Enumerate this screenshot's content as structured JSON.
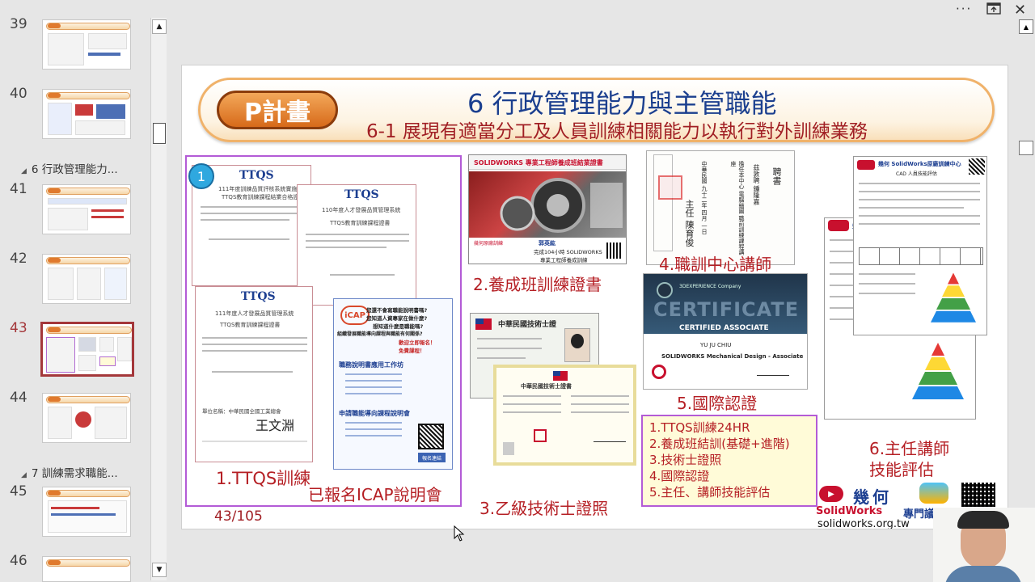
{
  "thumbnails": {
    "items": [
      {
        "number": "39"
      },
      {
        "number": "40"
      },
      {
        "number": "41"
      },
      {
        "number": "42"
      },
      {
        "number": "43",
        "active": true
      },
      {
        "number": "44"
      },
      {
        "number": "45"
      },
      {
        "number": "46"
      }
    ],
    "sections": [
      {
        "label": "6 行政管理能力..."
      },
      {
        "label": "7 訓練需求職能..."
      }
    ]
  },
  "window": {
    "more_icon": "more-icon",
    "restore_icon": "restore-icon",
    "close_icon": "close-icon"
  },
  "slide": {
    "badge": "P計畫",
    "title": "6 行政管理能力與主管職能",
    "subtitle": "6-1 展現有適當分工及人員訓練相關能力以執行對外訓練業務",
    "page_counter": "43/105",
    "ttqs_doc": {
      "number_badge": "1",
      "logo": "TTQS",
      "doc1_title": "111年度訓練品質評核系統實施計",
      "doc1_sub": "TTQS教育訓練課程結業合格證書",
      "doc2_title": "110年度人才發展品質管理系統",
      "doc2_sub": "TTQS教育訓練課程證書",
      "doc3_title": "111年度人才發展品質管理系統",
      "doc3_sub": "TTQS教育訓練課程證書",
      "signer_org": "單位名稱：中華民國全國工業總會",
      "signer_name": "王文淵",
      "caption": "1.TTQS訓練",
      "icap_caption": "已報名ICAP說明會"
    },
    "icap_flyer": {
      "logo": "iCAP",
      "q1": "您還不會寫職能說明書嗎?",
      "q2": "您知道人資專家在做什麼?",
      "q3": "想知道什麼是職能嗎?",
      "q4": "組織發展職能導向課程與職能有何關係?",
      "q5": "歡迎立即報名！",
      "q6": "免費課程！",
      "sec1": "職務說明書應用工作坊",
      "sec2": "申請職能導向課程說明會",
      "btn": "報名連結"
    },
    "cert2": {
      "header": "SOLIDWORKS 專業工程師養成班結業證書",
      "line1": "幾何原廠訓練",
      "name": "郭英紘",
      "line2": "完成104小時 SOLIDWORKS",
      "line3": "專業工程師養成訓練",
      "caption": "2.養成班訓練證書"
    },
    "cert3": {
      "id_header": "中華民國技術士證",
      "card_title": "中華民國技術士證書",
      "caption": "3.乙級技術士證照"
    },
    "cert4": {
      "hire": "聘書",
      "text1": "茲敦聘 鍾隆嘉",
      "text2": "擔任本中心 電腦繪圖 職前訓練課程講座",
      "director": "主任 陳育俊",
      "date": "中華民國 九十二年 四月 一日",
      "caption": "4.職訓中心講師"
    },
    "cert5": {
      "brand": "3DEXPERIENCE Company",
      "big": "CERTIFICATE",
      "banner": "CERTIFIED ASSOCIATE",
      "name": "YU JU CHIU",
      "course": "SOLIDWORKS Mechanical Design - Associate",
      "caption": "5.國際認證"
    },
    "cert6": {
      "header": "幾何 SolidWorks原廠訓練中心",
      "sub": "CAD 人員技能評估",
      "header2": "幾何",
      "caption_line1": "6.主任講師",
      "caption_line2": "技能評估"
    },
    "summary": [
      "1.TTQS訓練24HR",
      "2.養成班結訓(基礎+進階)",
      "3.技術士證照",
      "4.國際認證",
      "5.主任、講師技能評估"
    ],
    "footer": {
      "brand_cn": "幾何",
      "brand_en": "SolidWorks",
      "brand_tag": "專門議堂",
      "url": "solidworks.org.tw"
    }
  }
}
